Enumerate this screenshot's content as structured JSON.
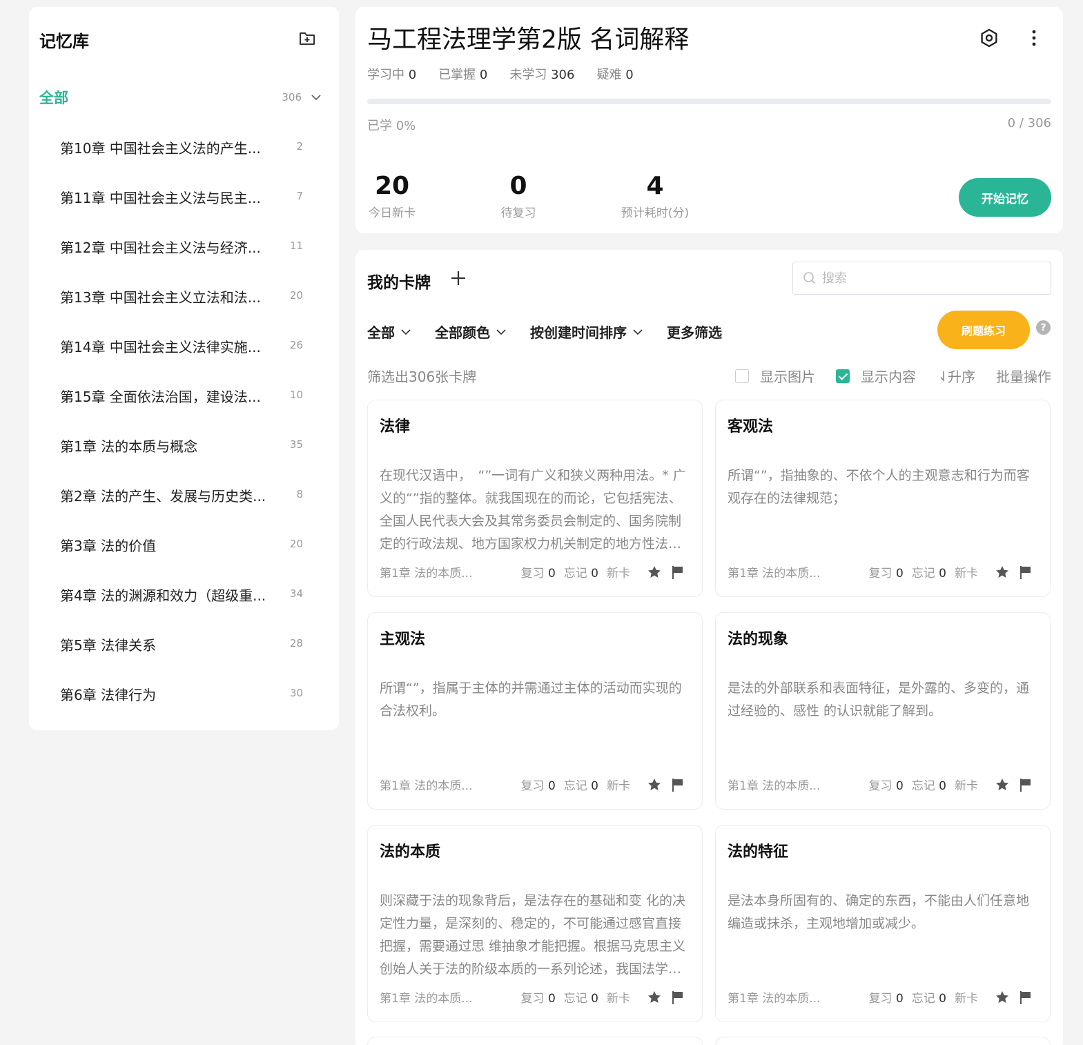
{
  "sidebar": {
    "title": "记忆库",
    "all": {
      "label": "全部",
      "count": "306"
    },
    "items": [
      {
        "label": "第10章 中国社会主义法的产生...",
        "count": "2"
      },
      {
        "label": "第11章 中国社会主义法与民主...",
        "count": "7"
      },
      {
        "label": "第12章 中国社会主义法与经济...",
        "count": "11"
      },
      {
        "label": "第13章 中国社会主义立法和法...",
        "count": "20"
      },
      {
        "label": "第14章 中国社会主义法律实施...",
        "count": "26"
      },
      {
        "label": "第15章 全面依法治国，建设法...",
        "count": "10"
      },
      {
        "label": "第1章 法的本质与概念",
        "count": "35"
      },
      {
        "label": "第2章 法的产生、发展与历史类...",
        "count": "8"
      },
      {
        "label": "第3章 法的价值",
        "count": "20"
      },
      {
        "label": "第4章 法的渊源和效力（超级重...",
        "count": "34"
      },
      {
        "label": "第5章 法律关系",
        "count": "28"
      },
      {
        "label": "第6章 法律行为",
        "count": "30"
      }
    ]
  },
  "deck": {
    "title": "马工程法理学第2版 名词解释",
    "stats": [
      {
        "label": "学习中",
        "value": "0"
      },
      {
        "label": "已掌握",
        "value": "0"
      },
      {
        "label": "未学习",
        "value": "306"
      },
      {
        "label": "疑难",
        "value": "0"
      }
    ],
    "progress_percent": 0,
    "learned_label": "已学 0%",
    "ratio": "0 / 306",
    "today_new": {
      "value": "20",
      "label": "今日新卡"
    },
    "pending": {
      "value": "0",
      "label": "待复习"
    },
    "estimate": {
      "value": "4",
      "label": "预计耗时(分)"
    },
    "start_label": "开始记忆"
  },
  "cards_panel": {
    "title": "我的卡牌",
    "search_placeholder": "搜索",
    "filters": [
      "全部",
      "全部颜色",
      "按创建时间排序"
    ],
    "more_filter": "更多筛选",
    "practice_label": "刷题练习",
    "help": "?",
    "count_text": "筛选出306张卡牌",
    "opt_show_image": "显示图片",
    "opt_show_content": "显示内容",
    "opt_sort": "升序",
    "opt_batch": "批量操作"
  },
  "cards": [
    {
      "title": "法律",
      "body": "在现代汉语中，　“”一词有广义和狭义两种用法。* 广义的“”指的整体。就我国现在的而论，它包括宪法、全国人民代表大会及其常务委员会制定的、国务院制定的行政法规、地方国家权力机关制定的地方性法规等。",
      "chapter": "第1章 法的本质...",
      "review": "0",
      "forget": "0",
      "state": "新卡"
    },
    {
      "title": "客观法",
      "body": "所谓“”，指抽象的、不依个人的主观意志和行为而客观存在的法律规范；",
      "chapter": "第1章 法的本质...",
      "review": "0",
      "forget": "0",
      "state": "新卡"
    },
    {
      "title": "主观法",
      "body": "所谓“”，指属于主体的并需通过主体的活动而实现的合法权利。",
      "chapter": "第1章 法的本质...",
      "review": "0",
      "forget": "0",
      "state": "新卡"
    },
    {
      "title": "法的现象",
      "body": "是法的外部联系和表面特征，是外露的、多变的，通过经验的、感性 的认识就能了解到。",
      "chapter": "第1章 法的本质...",
      "review": "0",
      "forget": "0",
      "state": "新卡"
    },
    {
      "title": "法的本质",
      "body": "则深藏于法的现象背后，是法存在的基础和变 化的决定性力量，是深刻的、稳定的，不可能通过感官直接把握，需要通过思 维抽象才能把握。根据马克思主义创始人关于法的阶级本质的一系列论述，我国法学界对此进行了归纳。",
      "chapter": "第1章 法的本质...",
      "review": "0",
      "forget": "0",
      "state": "新卡"
    },
    {
      "title": "法的特征",
      "body": "是法本身所固有的、确定的东西，不能由人们任意地编造或抹杀，主观地增加或减少。",
      "chapter": "第1章 法的本质...",
      "review": "0",
      "forget": "0",
      "state": "新卡"
    }
  ],
  "labels": {
    "review": "复习",
    "forget": "忘记"
  },
  "colors": {
    "accent": "#2bb597",
    "practice": "#f9b21a"
  },
  "icons": [
    "add-folder-icon",
    "chevron-down-icon",
    "gear-icon",
    "more-vertical-icon",
    "plus-icon",
    "search-icon",
    "star-icon",
    "flag-icon",
    "sort-arrow-icon"
  ]
}
